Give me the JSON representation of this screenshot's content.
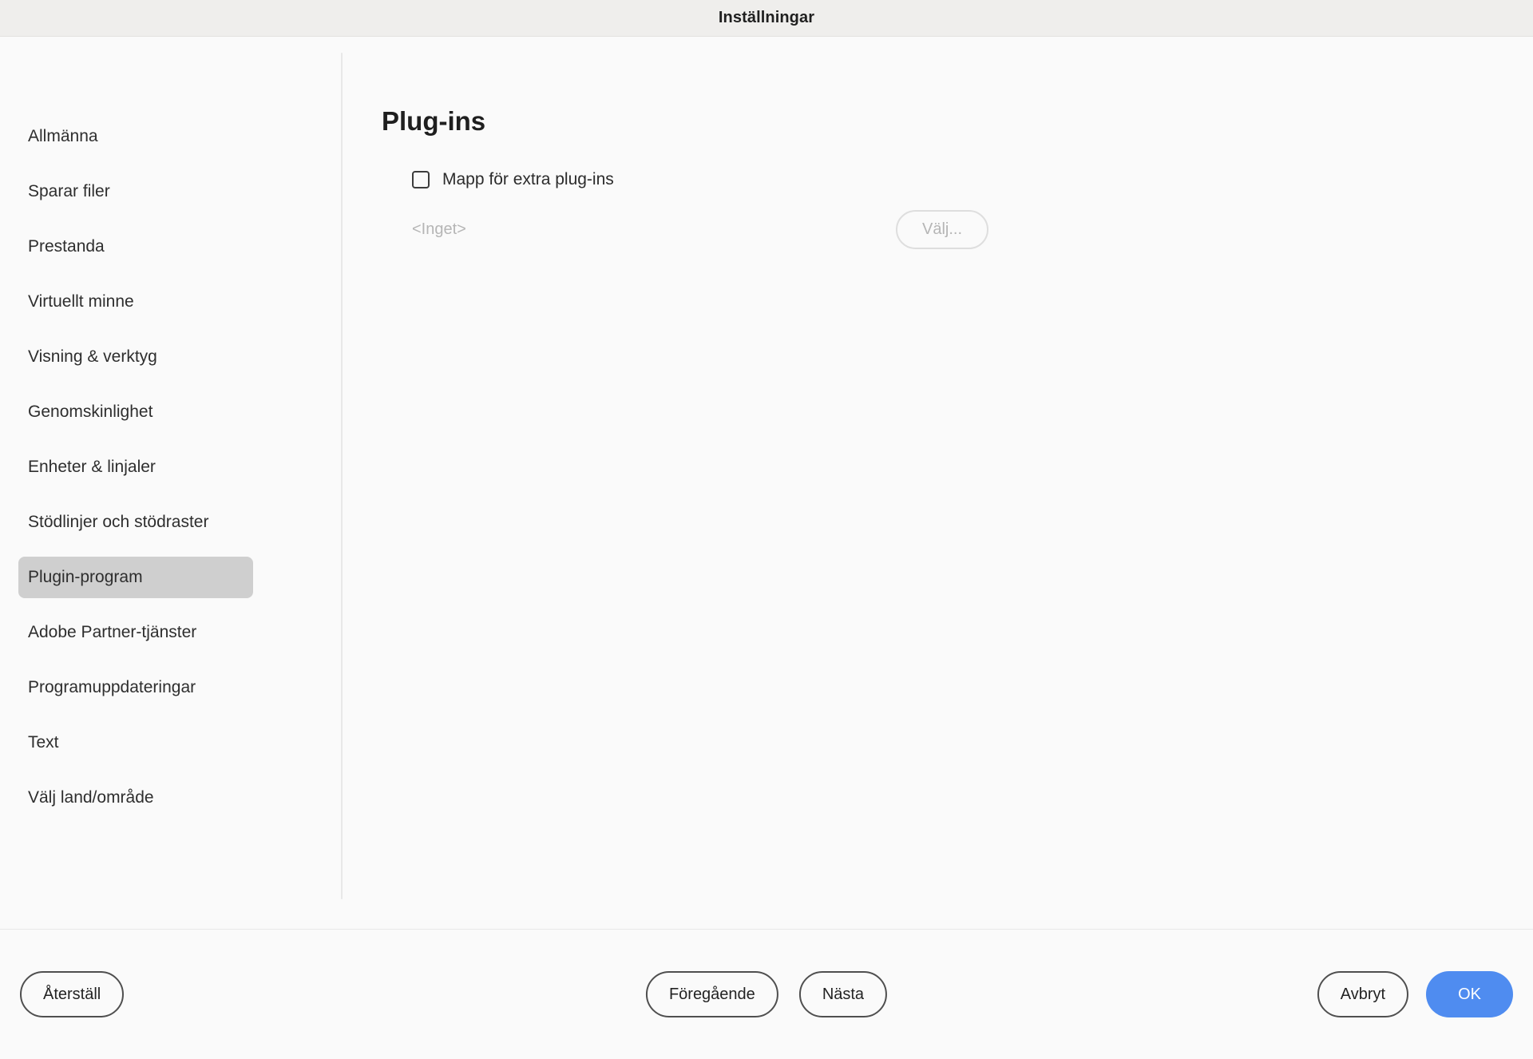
{
  "window": {
    "title": "Inställningar"
  },
  "sidebar": {
    "items": [
      {
        "label": "Allmänna",
        "selected": false
      },
      {
        "label": "Sparar filer",
        "selected": false
      },
      {
        "label": "Prestanda",
        "selected": false
      },
      {
        "label": "Virtuellt minne",
        "selected": false
      },
      {
        "label": "Visning & verktyg",
        "selected": false
      },
      {
        "label": "Genomskinlighet",
        "selected": false
      },
      {
        "label": "Enheter & linjaler",
        "selected": false
      },
      {
        "label": "Stödlinjer och stödraster",
        "selected": false
      },
      {
        "label": "Plugin-program",
        "selected": true
      },
      {
        "label": "Adobe Partner-tjänster",
        "selected": false
      },
      {
        "label": "Programuppdateringar",
        "selected": false
      },
      {
        "label": "Text",
        "selected": false
      },
      {
        "label": "Välj land/område",
        "selected": false
      }
    ]
  },
  "main": {
    "title": "Plug-ins",
    "extra_plugins_checkbox": {
      "label": "Mapp för extra plug-ins",
      "checked": false
    },
    "folder_path_value": "<Inget>",
    "choose_button_label": "Välj...",
    "choose_button_enabled": false
  },
  "footer": {
    "reset_label": "Återställ",
    "previous_label": "Föregående",
    "next_label": "Nästa",
    "cancel_label": "Avbryt",
    "ok_label": "OK"
  },
  "colors": {
    "titlebar_bg": "#efeeec",
    "body_bg": "#fafafa",
    "selected_item_bg": "#cfcfcf",
    "primary_button_bg": "#4f8cf0",
    "disabled_text": "#b5b5b5",
    "divider": "#e8e8e8"
  }
}
